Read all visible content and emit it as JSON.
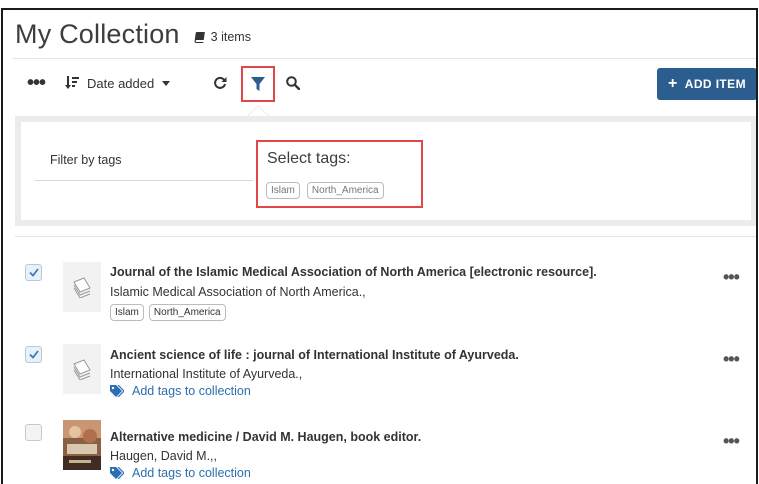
{
  "header": {
    "title": "My Collection",
    "item_count": "3 items"
  },
  "toolbar": {
    "sort_label": "Date added",
    "add_label": "ADD ITEM"
  },
  "filter_panel": {
    "label": "Filter by tags",
    "select_title": "Select tags:",
    "tags": [
      "Islam",
      "North_America"
    ]
  },
  "items": [
    {
      "title": "Journal of the Islamic Medical Association of North America [electronic resource].",
      "author": "Islamic Medical Association of North America.,",
      "tags": [
        "Islam",
        "North_America"
      ],
      "checked": true
    },
    {
      "title": "Ancient science of life : journal of International Institute of Ayurveda.",
      "author": "International Institute of Ayurveda.,",
      "add_tags": "Add tags to collection",
      "checked": true
    },
    {
      "title": "Alternative medicine / David M. Haugen, book editor.",
      "author": "Haugen, David M.,,",
      "add_tags": "Add tags to collection",
      "checked": false
    }
  ],
  "colors": {
    "accent": "#2b5d8e",
    "link": "#2b6fb2",
    "highlight": "#e04848"
  },
  "icons": {
    "count": "book-icon",
    "sort": "sort-icon",
    "refresh": "refresh-icon",
    "filter": "filter-icon",
    "search": "search-icon",
    "tag": "tag-icon",
    "document": "document-icon"
  }
}
